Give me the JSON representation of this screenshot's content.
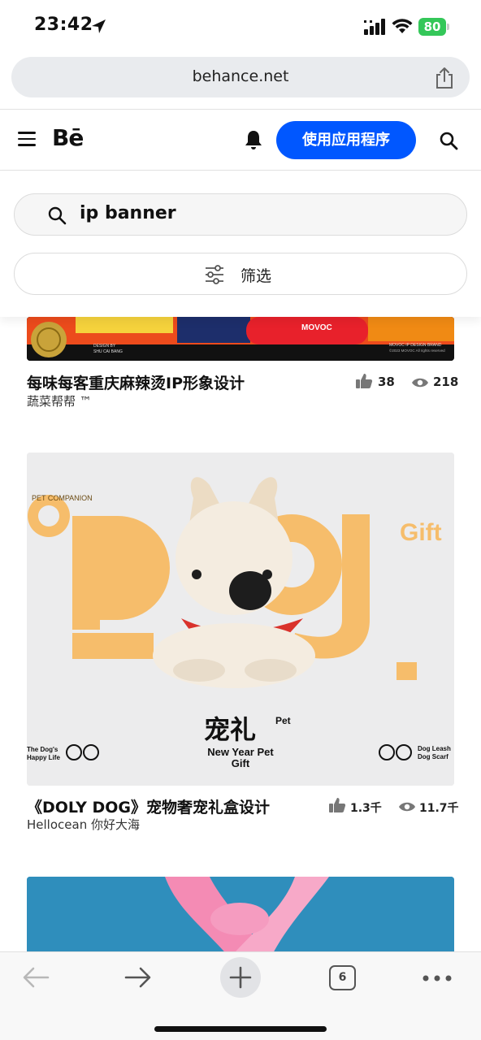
{
  "status_bar": {
    "time": "23:42",
    "battery": "80"
  },
  "browser": {
    "url": "behance.net",
    "open_tabs": "6"
  },
  "header": {
    "logo": "Bē",
    "app_button": "使用应用程序"
  },
  "search": {
    "query": "ip banner",
    "filter_label": "筛选"
  },
  "projects": [
    {
      "title": "每味每客重庆麻辣烫IP形象设计",
      "owner": "蔬菜帮帮 ™",
      "likes": "38",
      "views": "218",
      "image_texts": {
        "brand": "MOVOC",
        "credit": "DESIGN BY",
        "credit_name": "SHU CAI BANG",
        "footer": "MOVOC IP DESIGN BRAND",
        "copyright": "©2023 MOVOC All rights reserved"
      }
    },
    {
      "title": "《DOLY DOG》宠物奢宠礼盒设计",
      "owner": "Hellocean 你好大海",
      "likes": "1.3千",
      "views": "11.7千",
      "image_texts": {
        "badge": "PET COMPANION",
        "big_word": "Dog",
        "gift": "Gift",
        "cn_title": "宠礼",
        "pet": "Pet",
        "subtitle_1": "New Year Pet",
        "subtitle_2": "Gift",
        "left_1": "The Dog's",
        "left_2": "Happy Life",
        "right_1": "Dog Leash",
        "right_2": "Dog Scarf"
      }
    }
  ],
  "colors": {
    "accent": "#0057ff",
    "dog_orange": "#f6bd6b",
    "battery": "#34c759",
    "third_card_bg": "#2f8ebc",
    "pink": "#f48bb4"
  },
  "icons": [
    "location-arrow-icon",
    "signal-icon",
    "wifi-icon",
    "share-icon",
    "menu-icon",
    "bell-icon",
    "search-icon",
    "filter-icon",
    "thumb-up-icon",
    "eye-icon",
    "back-arrow-icon",
    "forward-arrow-icon",
    "plus-icon",
    "more-icon"
  ]
}
